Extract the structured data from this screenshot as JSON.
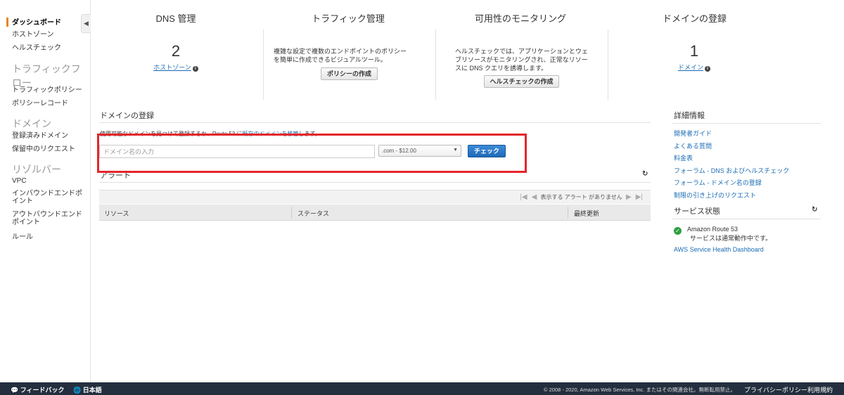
{
  "sidebar": {
    "dashboard": "ダッシュボード",
    "hosted_zones": "ホストゾーン",
    "health_checks": "ヘルスチェック",
    "group_traffic_flow": "トラフィックフロー",
    "traffic_policies": "トラフィックポリシー",
    "policy_records": "ポリシーレコード",
    "group_domains": "ドメイン",
    "registered_domains": "登録済みドメイン",
    "pending_requests": "保留中のリクエスト",
    "group_resolver": "リゾルバー",
    "vpc": "VPC",
    "inbound_endpoints": "インバウンドエンドポイント",
    "outbound_endpoints": "アウトバウンドエンドポイント",
    "rules": "ルール",
    "collapse_icon": "chevron-left-icon"
  },
  "summary": {
    "dns": {
      "title": "DNS 管理",
      "count": "2",
      "link": "ホストゾーン"
    },
    "traffic": {
      "title": "トラフィック管理",
      "desc1": "複雑な設定で複数のエンドポイントのポリシー",
      "desc2": "を簡単に作成できるビジュアルツール。",
      "button": "ポリシーの作成"
    },
    "monitoring": {
      "title": "可用性のモニタリング",
      "desc1": "ヘルスチェックでは、アプリケーションとウェ",
      "desc2": "ブリソースがモニタリングされ、正常なリソー",
      "desc3": "スに DNS クエリを誘導します。",
      "button": "ヘルスチェックの作成"
    },
    "registration": {
      "title": "ドメインの登録",
      "count": "1",
      "link": "ドメイン"
    }
  },
  "domain_reg": {
    "title": "ドメインの登録",
    "desc_prefix": "使用可能なドメインを見つけて登録するか、Route 53 に",
    "desc_link": "既存のドメインを移管",
    "desc_suffix": "します。",
    "input_placeholder": "ドメイン名の入力",
    "tld_value": ".com - $12.00",
    "check_button": "チェック"
  },
  "alerts": {
    "title": "アラート",
    "pager_text": "表示する アラート がありません",
    "columns": [
      "リソース",
      "ステータス",
      "最終更新"
    ]
  },
  "details": {
    "title": "詳細情報",
    "links": [
      "開発者ガイド",
      "よくある質問",
      "料金表",
      "フォーラム - DNS およびヘルスチェック",
      "フォーラム - ドメイン名の登録",
      "制限の引き上げのリクエスト"
    ]
  },
  "service_health": {
    "title": "サービス状態",
    "service": "Amazon Route 53",
    "status": "サービスは通常動作中です。",
    "dashboard_link": "AWS Service Health Dashboard"
  },
  "footer": {
    "feedback": "フィードバック",
    "language": "日本語",
    "copyright": "© 2008 - 2020, Amazon Web Services, Inc. またはその関連会社。無断転用禁止。",
    "privacy": "プライバシーポリシー",
    "terms": "利用規約"
  },
  "colors": {
    "accent": "#e8861a",
    "link": "#1a6bb3",
    "highlight": "#e5262b",
    "footer_bg": "#232f3e",
    "primary_button": "#1f6ab8"
  }
}
